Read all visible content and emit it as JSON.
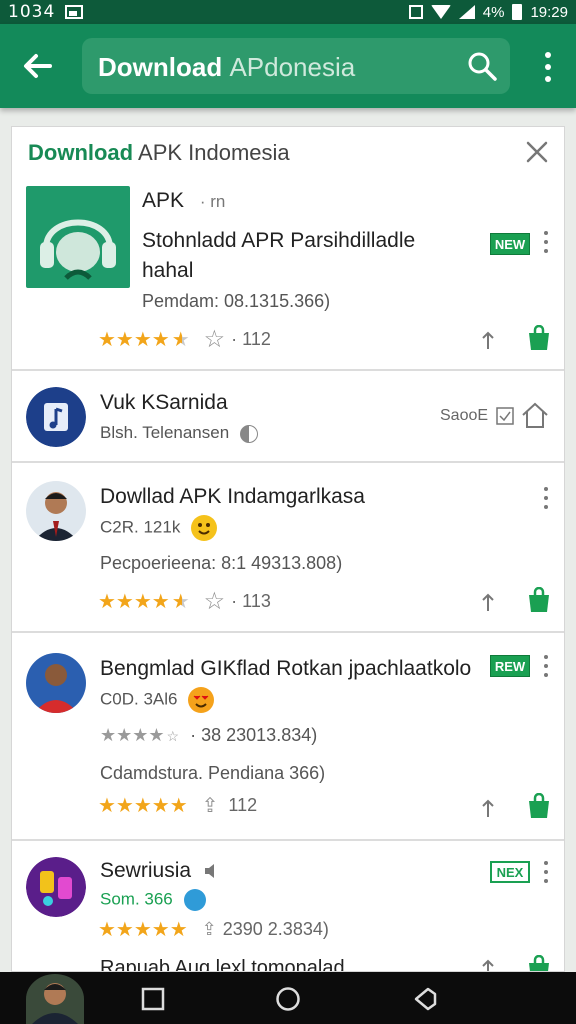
{
  "status_bar": {
    "time_left": "1034",
    "battery_percent": "4%",
    "time_right": "19:29"
  },
  "appbar": {
    "search_query_bold": "Download",
    "search_query_rest": "APdonesia"
  },
  "results_header": {
    "title_bold": "Download",
    "title_rest": "APK Indomesia"
  },
  "colors": {
    "brand_green": "#138a5a",
    "star_gold": "#f2a51a",
    "badge_green": "#1aa052"
  },
  "results": [
    {
      "name": "APK",
      "name_suffix": "· rn",
      "description_line1": "Stohnladd APR Parsihdilladle",
      "description_line2": "hahal",
      "meta": "Pemdam: 08.1315.366)",
      "rating_count": "· 112",
      "rating": 4.5,
      "badge": "NEW",
      "icon": "headphones-app-icon"
    },
    {
      "name": "Vuk KSarnida",
      "subtitle": "Blsh. Telenansen",
      "action_label": "SaooE",
      "icon": "music-note-app-icon"
    },
    {
      "name": "Dowllad APK Indamgarlkasa",
      "subtitle": "C2R. 121k",
      "meta": "Pecpoerieena: 8:1 49313.808)",
      "rating_count": "· 113",
      "rating": 4.5,
      "icon": "person-avatar"
    },
    {
      "name": "Bengmlad GIKflad Rotkan jpachlaatkolo",
      "subtitle": "C0D. 3Al6",
      "meta_line1": "· 38 23013.834)",
      "meta_line2": "Cdamdstura. Pendiana 366)",
      "rating_count": "112",
      "rating": 5,
      "badge": "REW",
      "icon": "person-avatar-red"
    },
    {
      "name": "Sewriusia",
      "subtitle": "Som. 366",
      "meta": "2390 2.3834)",
      "next_line": "Rapuab Aug lexl tomonalad",
      "rating": 5,
      "badge": "NEX",
      "icon": "game-app-icon"
    }
  ]
}
